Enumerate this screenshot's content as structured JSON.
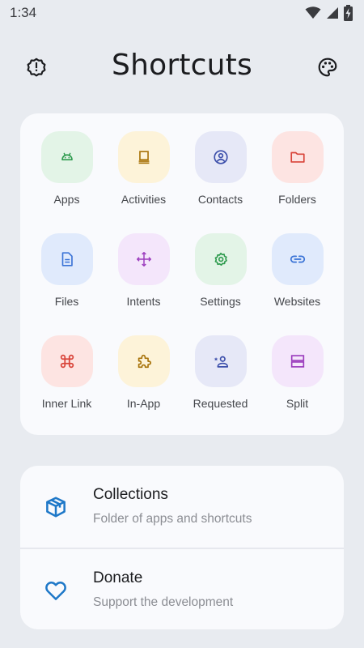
{
  "status_bar": {
    "time": "1:34"
  },
  "header": {
    "title": "Shortcuts",
    "left_icon": "info-gear-icon",
    "right_icon": "palette-icon"
  },
  "shortcuts": [
    {
      "label": "Apps",
      "icon": "android-icon",
      "bg": "#e3f4e7",
      "fg": "#2e9b4e"
    },
    {
      "label": "Activities",
      "icon": "activities-icon",
      "bg": "#fdf3d9",
      "fg": "#a8730a"
    },
    {
      "label": "Contacts",
      "icon": "contact-icon",
      "bg": "#e6e8f7",
      "fg": "#3b4eaa"
    },
    {
      "label": "Folders",
      "icon": "folder-icon",
      "bg": "#fde4e2",
      "fg": "#d9443a"
    },
    {
      "label": "Files",
      "icon": "file-icon",
      "bg": "#e0eafc",
      "fg": "#3a73d6"
    },
    {
      "label": "Intents",
      "icon": "move-arrows-icon",
      "bg": "#f4e6fb",
      "fg": "#9b3bbd"
    },
    {
      "label": "Settings",
      "icon": "gear-icon",
      "bg": "#e3f4e7",
      "fg": "#2e9b4e"
    },
    {
      "label": "Websites",
      "icon": "link-icon",
      "bg": "#e0eafc",
      "fg": "#3a73d6"
    },
    {
      "label": "Inner Link",
      "icon": "command-icon",
      "bg": "#fde4e2",
      "fg": "#d9443a"
    },
    {
      "label": "In-App",
      "icon": "puzzle-icon",
      "bg": "#fdf3d9",
      "fg": "#a8730a"
    },
    {
      "label": "Requested",
      "icon": "person-star-icon",
      "bg": "#e6e8f7",
      "fg": "#3b4eaa"
    },
    {
      "label": "Split",
      "icon": "split-icon",
      "bg": "#f4e6fb",
      "fg": "#9b3bbd"
    }
  ],
  "menu": [
    {
      "title": "Collections",
      "subtitle": "Folder of apps and shortcuts",
      "icon": "box-icon",
      "color": "#1e78c8"
    },
    {
      "title": "Donate",
      "subtitle": "Support the development",
      "icon": "heart-icon",
      "color": "#1e78c8"
    }
  ]
}
